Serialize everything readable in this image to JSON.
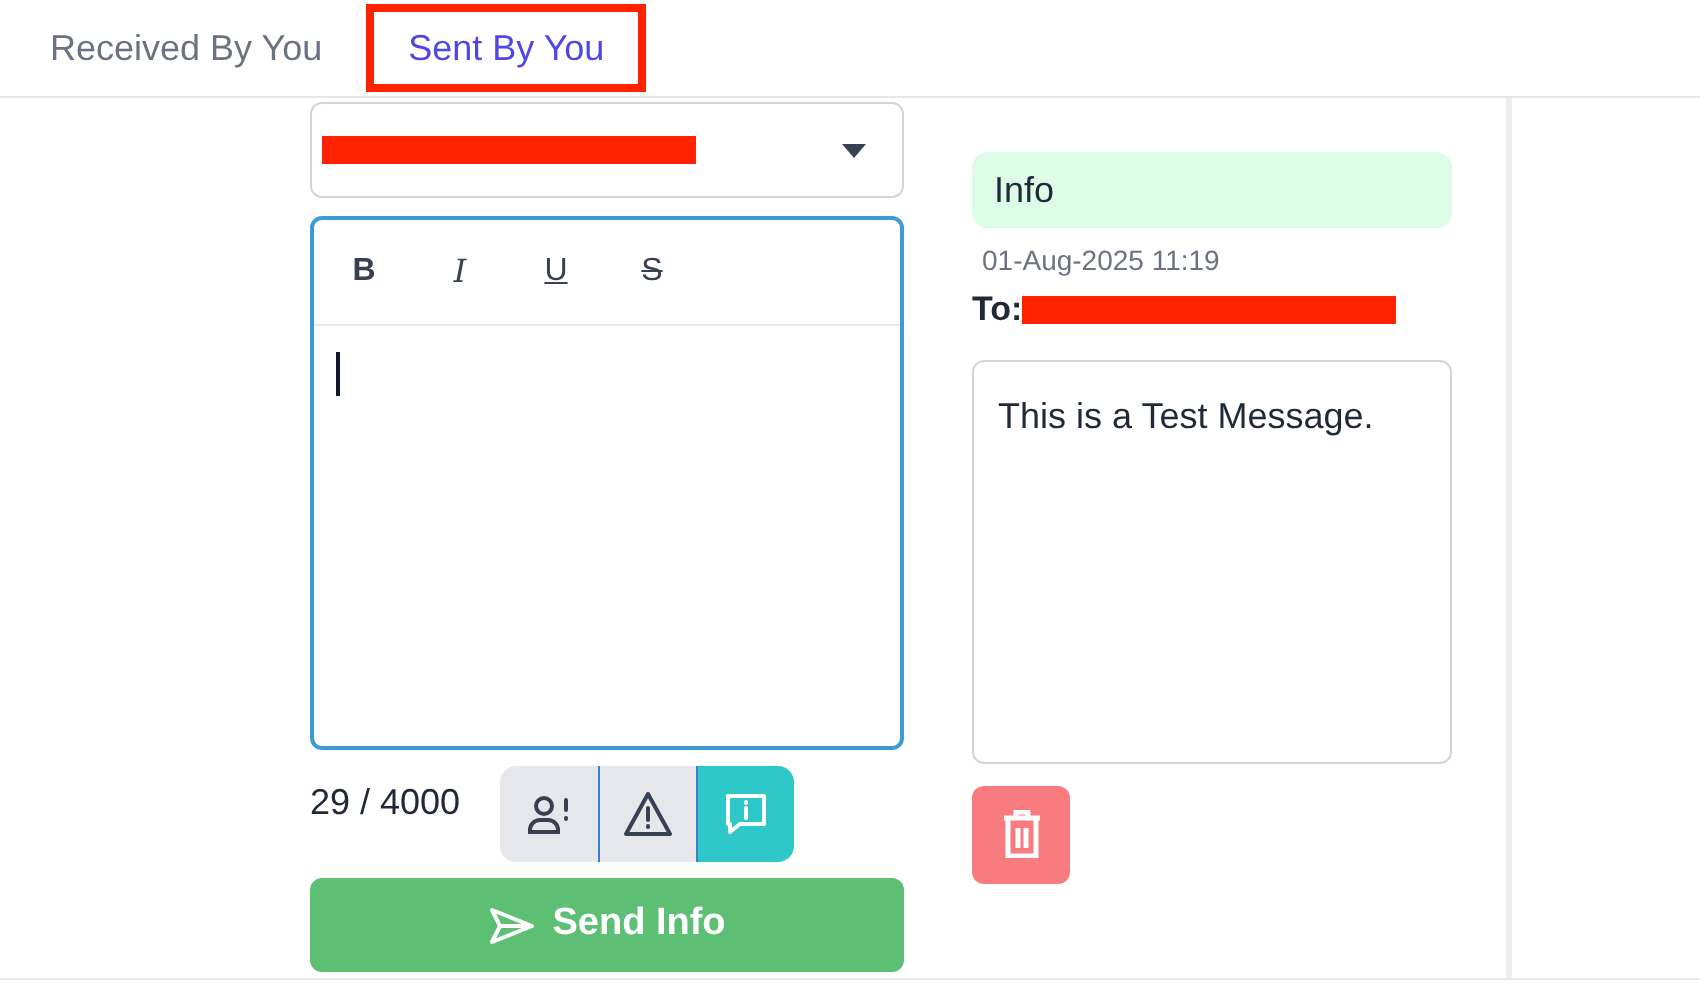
{
  "tabs": [
    {
      "label": "Received By You",
      "selected": false
    },
    {
      "label": "Sent By You",
      "selected": true,
      "highlighted": true
    }
  ],
  "compose": {
    "recipient_redacted": true,
    "format_buttons": [
      {
        "kind": "bold",
        "label": "B"
      },
      {
        "kind": "italic",
        "label": "I"
      },
      {
        "kind": "underline",
        "label": "U"
      },
      {
        "kind": "strike",
        "label": "S"
      }
    ],
    "counter": "29 / 4000",
    "message_types": [
      {
        "kind": "person-alert",
        "selected": false
      },
      {
        "kind": "warning",
        "selected": false
      },
      {
        "kind": "info",
        "selected": true
      }
    ],
    "send_button": "Send Info"
  },
  "sent_message": {
    "type": "Info",
    "time": "01-Aug-2025 11:19",
    "to_label": "To:",
    "recipient_redacted": true,
    "body": "This is a Test Message."
  }
}
